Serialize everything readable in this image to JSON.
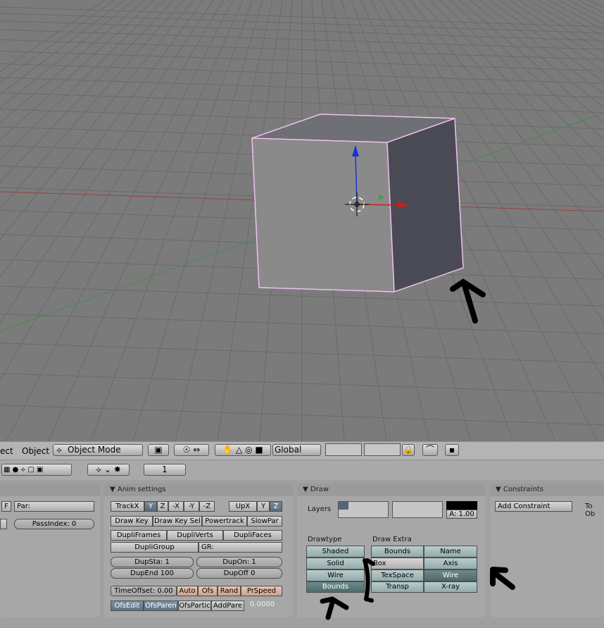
{
  "header": {
    "menu_select": "ect",
    "menu_object": "Object",
    "mode": "Object Mode",
    "orientation": "Global"
  },
  "buttonbar": {
    "frame": "1"
  },
  "panels": {
    "object": {
      "par_label": "Par:",
      "passindex": "PassIndex: 0",
      "f_btn": "F"
    },
    "anim": {
      "title": "Anim settings",
      "track": [
        "TrackX",
        "Y",
        "Z",
        "-X",
        "-Y",
        "-Z"
      ],
      "up": [
        "UpX",
        "Y",
        "Z"
      ],
      "row2": [
        "Draw Key",
        "Draw Key Sel",
        "Powertrack",
        "SlowPar"
      ],
      "dupli": [
        "DupliFrames",
        "DupliVerts",
        "DupliFaces"
      ],
      "dupligroup": "DupliGroup",
      "gr": "GR:",
      "dupsta": "DupSta: 1",
      "dupon": "DupOn: 1",
      "dupend": "DupEnd 100",
      "dupoff": "DupOff 0",
      "timeoffset": "TimeOffset: 0.00",
      "row_time": [
        "Auto",
        "Ofs",
        "Rand",
        "PrSpeed"
      ],
      "row_ofs": [
        "OfsEdit",
        "OfsParen",
        "OfsPartic",
        "AddPare"
      ],
      "speed_value": "0.0000"
    },
    "draw": {
      "title": "Draw",
      "layers_label": "Layers",
      "alpha": "A: 1.00",
      "drawtype_label": "Drawtype",
      "drawextra_label": "Draw Extra",
      "drawtype": [
        "Shaded",
        "Solid",
        "Wire",
        "Bounds"
      ],
      "extra_left": [
        "Bounds",
        "Box",
        "TexSpace",
        "Transp"
      ],
      "extra_right": [
        "Name",
        "Axis",
        "Wire",
        "X-ray"
      ]
    },
    "constraints": {
      "title": "Constraints",
      "add": "Add Constraint",
      "to_ob": "To Ob"
    }
  },
  "colors": {
    "selection": "#f0c0f0",
    "x_axis": "#c02020",
    "y_axis": "#30b030",
    "z_axis": "#2030d0"
  }
}
